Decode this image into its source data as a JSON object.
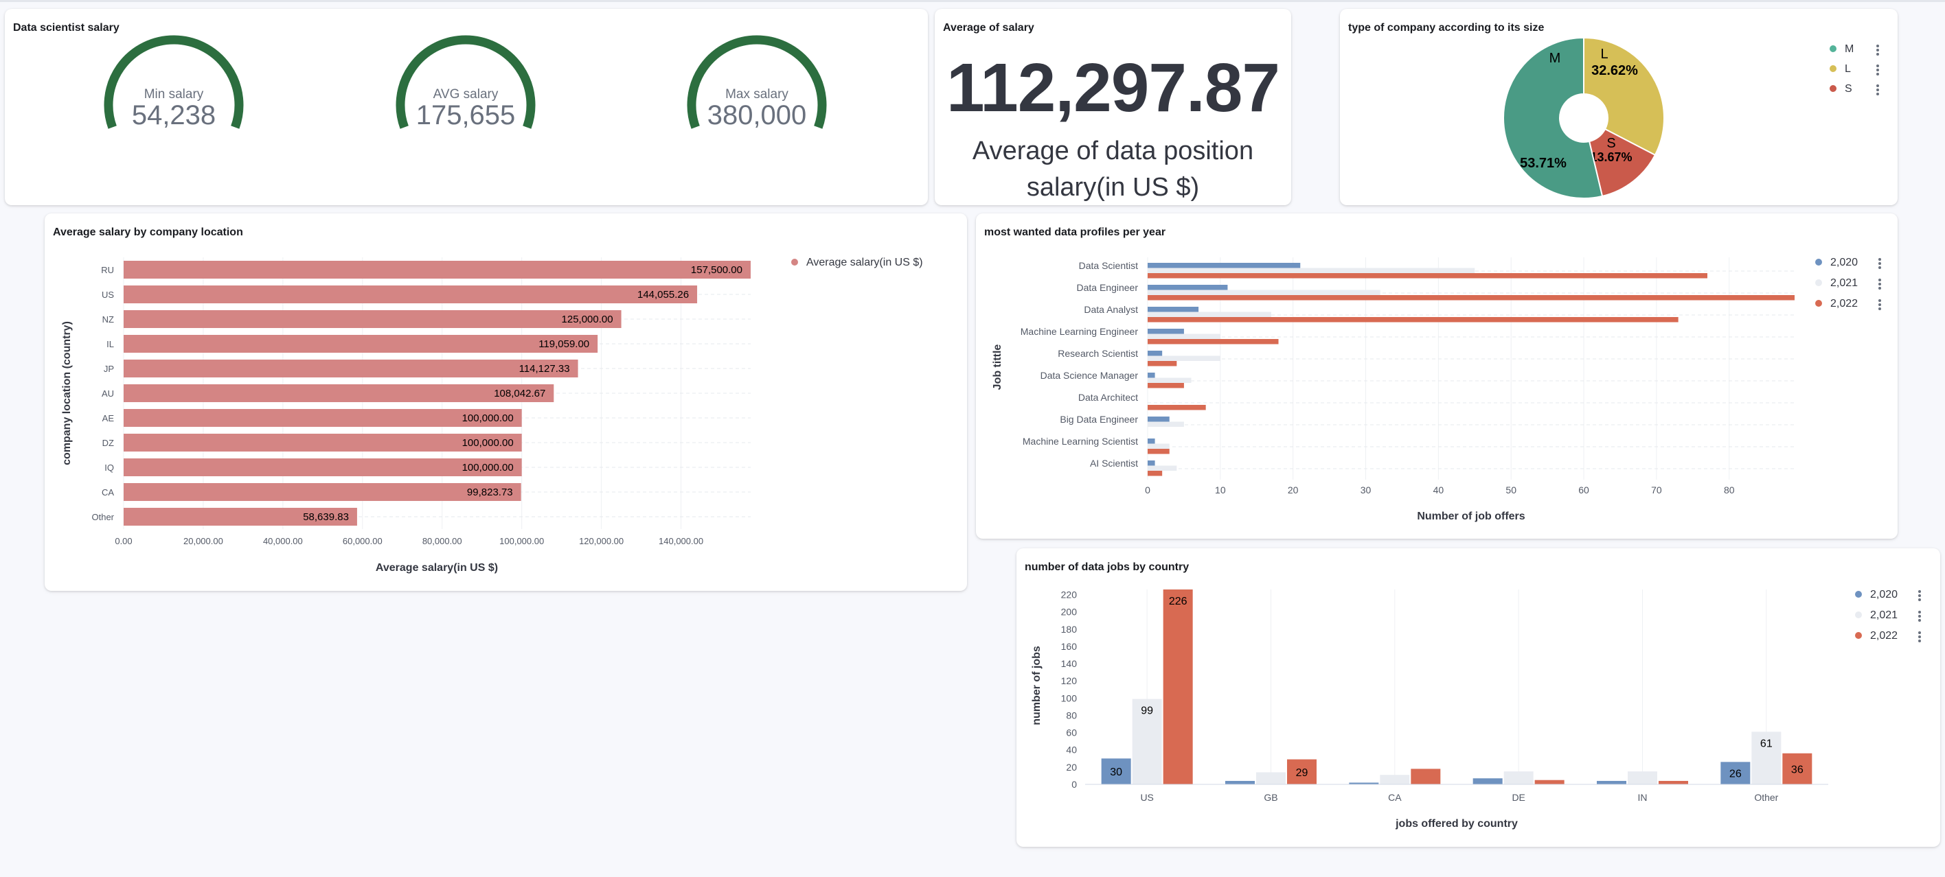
{
  "colors": {
    "gauge": "#2c6e3f",
    "pie_m": "#54b399",
    "pie_m_dark": "#4a9b85",
    "pie_l": "#d6bf57",
    "pie_s": "#ca5a4b",
    "bar_location": "#d48584",
    "year_2020": "#6e92c0",
    "year_2021": "#e9ecf1",
    "year_2022": "#d86a52",
    "text": "#343741"
  },
  "gauges": {
    "title": "Data scientist salary",
    "items": [
      {
        "label": "Min salary",
        "value": "54,238"
      },
      {
        "label": "AVG salary",
        "value": "175,655"
      },
      {
        "label": "Max salary",
        "value": "380,000"
      }
    ]
  },
  "metric": {
    "title": "Average of salary",
    "value": "112,297.87",
    "caption_line1": "Average of data position",
    "caption_line2": "salary(in US $)"
  },
  "pie": {
    "title": "type of company according to its size",
    "legend": [
      {
        "label": "M",
        "color_key": "pie_m"
      },
      {
        "label": "L",
        "color_key": "pie_l"
      },
      {
        "label": "S",
        "color_key": "pie_s"
      }
    ]
  },
  "location_chart": {
    "title": "Average salary by company location",
    "legend_label": "Average salary(in US $)"
  },
  "profiles_chart": {
    "title": "most wanted data profiles per year",
    "legend": [
      "2,020",
      "2,021",
      "2,022"
    ]
  },
  "country_chart": {
    "title": "number of data jobs by country",
    "legend": [
      "2,020",
      "2,021",
      "2,022"
    ]
  },
  "chart_data": [
    {
      "type": "pie",
      "title": "type of company according to its size",
      "donut": true,
      "slices": [
        {
          "label": "M",
          "value": 53.71,
          "display": "53.71%"
        },
        {
          "label": "L",
          "value": 32.62,
          "display": "32.62%"
        },
        {
          "label": "S",
          "value": 13.67,
          "display": "13.67%"
        }
      ],
      "legend_position": "top-right"
    },
    {
      "type": "bar",
      "orientation": "horizontal",
      "title": "Average salary by company location",
      "xlabel": "Average salary(in US $)",
      "ylabel": "company location (country)",
      "categories": [
        "RU",
        "US",
        "NZ",
        "IL",
        "JP",
        "AU",
        "AE",
        "DZ",
        "IQ",
        "CA",
        "Other"
      ],
      "values": [
        157500,
        144055.26,
        125000,
        119059,
        114127.33,
        108042.67,
        100000,
        100000,
        100000,
        99823.73,
        58639.83
      ],
      "value_labels": [
        "157,500.00",
        "144,055.26",
        "125,000.00",
        "119,059.00",
        "114,127.33",
        "108,042.67",
        "100,000.00",
        "100,000.00",
        "100,000.00",
        "99,823.73",
        "58,639.83"
      ],
      "xlim": [
        0,
        157500
      ],
      "xticks": [
        "0.00",
        "20,000.00",
        "40,000.00",
        "60,000.00",
        "80,000.00",
        "100,000.00",
        "120,000.00",
        "140,000.00"
      ],
      "xtick_values": [
        0,
        20000,
        40000,
        60000,
        80000,
        100000,
        120000,
        140000
      ],
      "series_name": "Average salary(in US $)",
      "grid": true,
      "legend_position": "top-right"
    },
    {
      "type": "bar",
      "orientation": "horizontal",
      "title": "most wanted data profiles per year",
      "xlabel": "Number of job offers",
      "ylabel": "Job tittle",
      "categories": [
        "Data Scientist",
        "Data Engineer",
        "Data Analyst",
        "Machine Learning Engineer",
        "Research Scientist",
        "Data Science Manager",
        "Data Architect",
        "Big Data Engineer",
        "Machine Learning Scientist",
        "AI Scientist"
      ],
      "series": [
        {
          "name": "2,020",
          "values": [
            21,
            11,
            7,
            5,
            2,
            1,
            0,
            3,
            1,
            1
          ]
        },
        {
          "name": "2,021",
          "values": [
            45,
            32,
            17,
            10,
            10,
            6,
            0,
            5,
            3,
            4
          ]
        },
        {
          "name": "2,022",
          "values": [
            77,
            89,
            73,
            18,
            4,
            5,
            8,
            0,
            3,
            2
          ]
        }
      ],
      "xlim": [
        0,
        89
      ],
      "xticks": [
        "0",
        "10",
        "20",
        "30",
        "40",
        "50",
        "60",
        "70",
        "80"
      ],
      "xtick_values": [
        0,
        10,
        20,
        30,
        40,
        50,
        60,
        70,
        80
      ],
      "grid": true,
      "legend_position": "top-right"
    },
    {
      "type": "bar",
      "orientation": "vertical",
      "title": "number of data jobs by country",
      "xlabel": "jobs offered by country",
      "ylabel": "number of jobs",
      "categories": [
        "US",
        "GB",
        "CA",
        "DE",
        "IN",
        "Other"
      ],
      "series": [
        {
          "name": "2,020",
          "values": [
            30,
            4,
            2,
            7,
            4,
            26
          ]
        },
        {
          "name": "2,021",
          "values": [
            99,
            14,
            11,
            15,
            15,
            61
          ]
        },
        {
          "name": "2,022",
          "values": [
            226,
            29,
            18,
            5,
            4,
            36
          ]
        }
      ],
      "labeled_values": {
        "US": [
          "30",
          "99",
          "226"
        ],
        "GB": [
          "",
          "",
          "29"
        ],
        "Other": [
          "26",
          "61",
          "36"
        ]
      },
      "ylim": [
        0,
        226
      ],
      "yticks": [
        "0",
        "20",
        "40",
        "60",
        "80",
        "100",
        "120",
        "140",
        "160",
        "180",
        "200",
        "220"
      ],
      "ytick_values": [
        0,
        20,
        40,
        60,
        80,
        100,
        120,
        140,
        160,
        180,
        200,
        220
      ],
      "grid": true,
      "legend_position": "top-right"
    }
  ]
}
